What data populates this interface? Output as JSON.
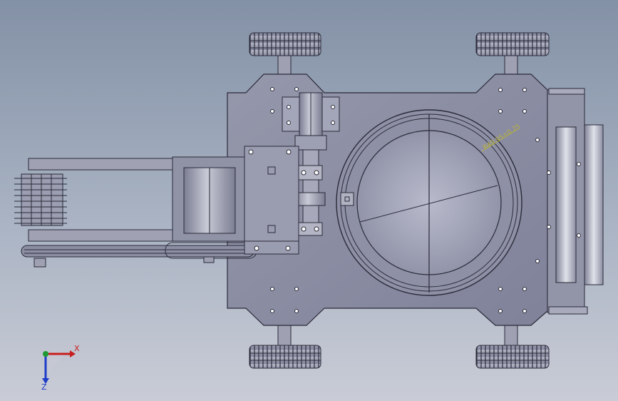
{
  "viewport": {
    "background_top": "#8391a6",
    "background_bottom": "#c9ccd6",
    "part_fill": "#8d8ea3",
    "part_edge": "#2a2a38"
  },
  "annotation": {
    "dimension_text": "R49.95±0.25",
    "color": "#b8b23a"
  },
  "triad": {
    "x_label": "X",
    "z_label": "Z",
    "x_color": "#c81e1e",
    "z_color": "#1e3cc8",
    "y_color": "#1e9a32"
  }
}
